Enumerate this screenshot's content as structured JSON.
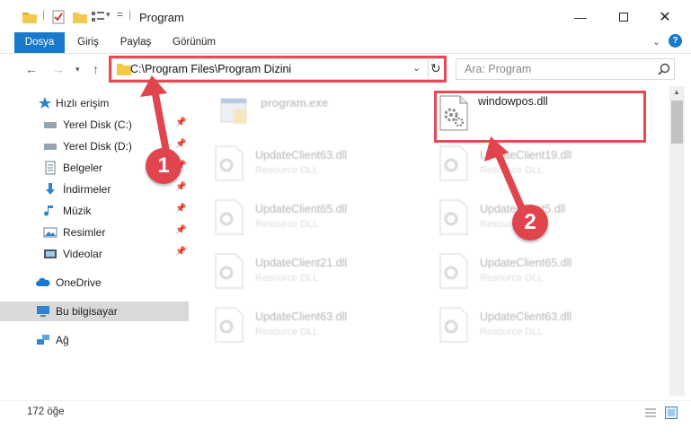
{
  "window": {
    "title": "Program"
  },
  "ribbon": {
    "tabs": [
      "Dosya",
      "Giriş",
      "Paylaş",
      "Görünüm"
    ]
  },
  "address": {
    "path": "C:\\Program Files\\Program Dizini",
    "search_placeholder": "Ara: Program"
  },
  "sidebar": {
    "items": [
      {
        "label": "Hızlı erişim",
        "icon": "star-icon"
      },
      {
        "label": "Yerel Disk (C:)",
        "icon": "drive-icon",
        "pinned": true
      },
      {
        "label": "Yerel Disk (D:)",
        "icon": "drive-icon",
        "pinned": true
      },
      {
        "label": "Belgeler",
        "icon": "document-icon",
        "pinned": true
      },
      {
        "label": "İndirmeler",
        "icon": "download-icon",
        "pinned": true
      },
      {
        "label": "Müzik",
        "icon": "music-icon",
        "pinned": true
      },
      {
        "label": "Resimler",
        "icon": "picture-icon",
        "pinned": true
      },
      {
        "label": "Videolar",
        "icon": "video-icon",
        "pinned": true
      },
      {
        "label": "OneDrive",
        "icon": "cloud-icon"
      },
      {
        "label": "Bu bilgisayar",
        "icon": "computer-icon",
        "selected": true
      },
      {
        "label": "Ağ",
        "icon": "network-icon"
      }
    ]
  },
  "files": [
    {
      "name": "program.exe",
      "type": ""
    },
    {
      "name": "windowpos.dll",
      "type": ""
    },
    {
      "name": "UpdateClient63.dll",
      "type": "Resource DLL"
    },
    {
      "name": "UpdateClient19.dll",
      "type": "Resource DLL"
    },
    {
      "name": "UpdateClient65.dll",
      "type": "Resource DLL"
    },
    {
      "name": "UpdateClient5.dll",
      "type": "Resource DLL"
    },
    {
      "name": "UpdateClient21.dll",
      "type": "Resource DLL"
    },
    {
      "name": "UpdateClient65.dll",
      "type": "Resource DLL"
    },
    {
      "name": "UpdateClient63.dll",
      "type": "Resource DLL"
    },
    {
      "name": "UpdateClient63.dll",
      "type": "Resource DLL"
    }
  ],
  "status": {
    "count": "172 öğe"
  },
  "annotations": {
    "step1": "1",
    "step2": "2",
    "color": "#e0454e"
  },
  "colors": {
    "accent": "#1979ca"
  }
}
